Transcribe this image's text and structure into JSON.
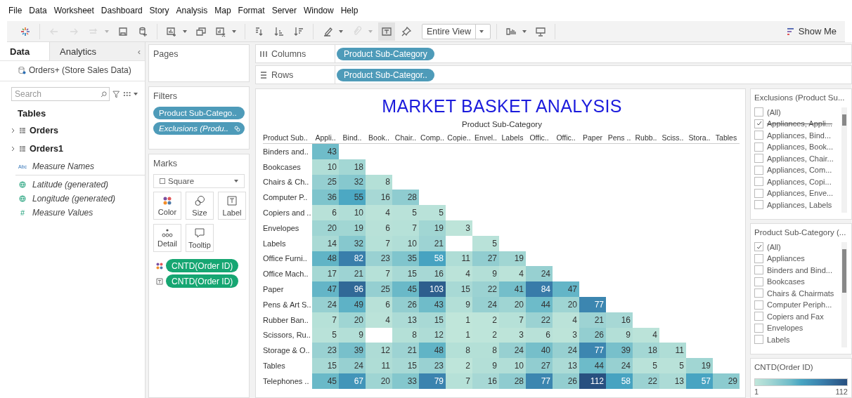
{
  "menu": [
    "File",
    "Data",
    "Worksheet",
    "Dashboard",
    "Story",
    "Analysis",
    "Map",
    "Format",
    "Server",
    "Window",
    "Help"
  ],
  "toolbar": [
    [
      {
        "kind": "logo",
        "disabled": false,
        "dropdown": false,
        "pressed": false
      }
    ],
    [
      {
        "kind": "back",
        "disabled": true,
        "dropdown": false,
        "pressed": false
      },
      {
        "kind": "forward",
        "disabled": true,
        "dropdown": false,
        "pressed": false
      },
      {
        "kind": "redo",
        "disabled": true,
        "dropdown": true,
        "pressed": false
      },
      {
        "kind": "save",
        "disabled": false,
        "dropdown": false,
        "pressed": false
      },
      {
        "kind": "new-data-source",
        "disabled": false,
        "dropdown": false,
        "pressed": false
      }
    ],
    [
      {
        "kind": "new-sheet",
        "disabled": false,
        "dropdown": true,
        "pressed": false
      },
      {
        "kind": "duplicate",
        "disabled": false,
        "dropdown": false,
        "pressed": false
      },
      {
        "kind": "clear-sheet",
        "disabled": false,
        "dropdown": true,
        "pressed": false
      }
    ],
    [
      {
        "kind": "swap",
        "disabled": false,
        "dropdown": false,
        "pressed": false
      },
      {
        "kind": "sort-ascending",
        "disabled": false,
        "dropdown": false,
        "pressed": false
      },
      {
        "kind": "sort-descending",
        "disabled": false,
        "dropdown": false,
        "pressed": false
      }
    ],
    [
      {
        "kind": "highlight",
        "disabled": false,
        "dropdown": true,
        "pressed": false
      },
      {
        "kind": "group",
        "disabled": true,
        "dropdown": true,
        "pressed": false
      },
      {
        "kind": "labels",
        "disabled": false,
        "dropdown": false,
        "pressed": true
      },
      {
        "kind": "pin",
        "disabled": false,
        "dropdown": false,
        "pressed": false
      },
      {
        "kind": "fit",
        "label": "Entire View",
        "disabled": false,
        "dropdown": true,
        "pressed": false
      }
    ],
    [
      {
        "kind": "cards",
        "disabled": false,
        "dropdown": true,
        "pressed": false
      },
      {
        "kind": "presentation",
        "disabled": false,
        "dropdown": false,
        "pressed": false
      }
    ]
  ],
  "show_me": "Show Me",
  "data_pane": {
    "tabs": [
      {
        "label": "Data",
        "selected": true
      },
      {
        "label": "Analytics",
        "selected": false
      }
    ],
    "collapse": "‹",
    "datasource": "Orders+ (Store Sales Data)",
    "search": {
      "placeholder": "Search"
    },
    "tables_heading": "Tables",
    "tables": [
      {
        "name": "Orders",
        "expanded": false
      },
      {
        "name": "Orders1",
        "expanded": false
      }
    ],
    "fields": [
      {
        "name": "Measure Names",
        "kind": "string",
        "icon": "Abc"
      },
      {
        "name": "Latitude (generated)",
        "kind": "geo"
      },
      {
        "name": "Longitude (generated)",
        "kind": "geo"
      },
      {
        "name": "Measure Values",
        "kind": "measure",
        "icon": "#"
      }
    ]
  },
  "pages": {
    "title": "Pages"
  },
  "filters": {
    "title": "Filters",
    "pills": [
      {
        "label": "Product Sub-Catego..",
        "italic": false,
        "linked": false
      },
      {
        "label": "Exclusions (Produ..",
        "italic": true,
        "linked": true
      }
    ]
  },
  "marks": {
    "title": "Marks",
    "mark_type": "Square",
    "buttons": [
      {
        "label": "Color",
        "kind": "color"
      },
      {
        "label": "Size",
        "kind": "size"
      },
      {
        "label": "Label",
        "kind": "label"
      },
      {
        "label": "Detail",
        "kind": "detail"
      },
      {
        "label": "Tooltip",
        "kind": "tooltip"
      }
    ],
    "pills": [
      {
        "label": "CNTD(Order ID)",
        "kind": "color"
      },
      {
        "label": "CNTD(Order ID)",
        "kind": "label"
      }
    ]
  },
  "shelves": [
    {
      "label": "Columns",
      "kind": "columns",
      "pills": [
        "Product Sub-Category"
      ]
    },
    {
      "label": "Rows",
      "kind": "rows",
      "pills": [
        "Product Sub-Categor.."
      ]
    }
  ],
  "view": {
    "title": "MARKET BASKET ANALYSIS",
    "subtitle": "Product Sub-Category",
    "corner": "Product Sub..",
    "columns": [
      "Appli..",
      "Bind..",
      "Book..",
      "Chair..",
      "Comp..",
      "Copie..",
      "Envel..",
      "Labels",
      "Offic..",
      "Offic..",
      "Paper",
      "Pens ..",
      "Rubb..",
      "Sciss..",
      "Stora..",
      "Tables"
    ],
    "rows": [
      {
        "label": "Binders and..",
        "cells": [
          "43"
        ]
      },
      {
        "label": "Bookcases",
        "cells": [
          "10",
          "18"
        ]
      },
      {
        "label": "Chairs & Ch..",
        "cells": [
          "25",
          "32",
          "8"
        ]
      },
      {
        "label": "Computer P..",
        "cells": [
          "36",
          "55",
          "16",
          "28"
        ]
      },
      {
        "label": "Copiers and ..",
        "cells": [
          "6",
          "10",
          "4",
          "5",
          "5"
        ]
      },
      {
        "label": "Envelopes",
        "cells": [
          "20",
          "19",
          "6",
          "7",
          "19",
          "3"
        ]
      },
      {
        "label": "Labels",
        "cells": [
          "14",
          "32",
          "7",
          "10",
          "21",
          null,
          "5"
        ]
      },
      {
        "label": "Office Furni..",
        "cells": [
          "48",
          "82",
          "23",
          "35",
          "58",
          "11",
          "27",
          "19"
        ]
      },
      {
        "label": "Office Mach..",
        "cells": [
          "17",
          "21",
          "7",
          "15",
          "16",
          "4",
          "9",
          "4",
          "24"
        ]
      },
      {
        "label": "Paper",
        "cells": [
          "47",
          "96",
          "25",
          "45",
          "103",
          "15",
          "22",
          "41",
          "84",
          "47"
        ]
      },
      {
        "label": "Pens & Art S..",
        "cells": [
          "24",
          "49",
          "6",
          "26",
          "43",
          "9",
          "24",
          "20",
          "44",
          "20",
          "77"
        ]
      },
      {
        "label": "Rubber Ban..",
        "cells": [
          "7",
          "20",
          "4",
          "13",
          "15",
          "1",
          "2",
          "7",
          "22",
          "4",
          "21",
          "16"
        ]
      },
      {
        "label": "Scissors, Ru..",
        "cells": [
          "5",
          "9",
          null,
          "8",
          "12",
          "1",
          "2",
          "3",
          "6",
          "3",
          "26",
          "9",
          "4"
        ]
      },
      {
        "label": "Storage & O..",
        "cells": [
          "23",
          "39",
          "12",
          "21",
          "48",
          "8",
          "8",
          "24",
          "40",
          "24",
          "77",
          "39",
          "18",
          "11"
        ]
      },
      {
        "label": "Tables",
        "cells": [
          "15",
          "24",
          "11",
          "15",
          "23",
          "2",
          "9",
          "10",
          "27",
          "13",
          "44",
          "24",
          "5",
          "5",
          "19"
        ]
      },
      {
        "label": "Telephones ..",
        "cells": [
          "45",
          "67",
          "20",
          "33",
          "79",
          "7",
          "16",
          "28",
          "77",
          "26",
          "112",
          "58",
          "22",
          "13",
          "57",
          "29"
        ]
      }
    ]
  },
  "quick_filters": [
    {
      "title": "Exclusions (Product Su...",
      "kind": "exclude",
      "items": [
        {
          "label": "(All)",
          "checked": false
        },
        {
          "label": "Appliances, Appli...",
          "checked": true
        },
        {
          "label": "Appliances, Bind...",
          "checked": false
        },
        {
          "label": "Appliances, Book...",
          "checked": false
        },
        {
          "label": "Appliances, Chair...",
          "checked": false
        },
        {
          "label": "Appliances, Com...",
          "checked": false
        },
        {
          "label": "Appliances, Copi...",
          "checked": false
        },
        {
          "label": "Appliances, Enve...",
          "checked": false
        },
        {
          "label": "Appliances, Labels",
          "checked": false
        }
      ]
    },
    {
      "title": "Product Sub-Category (...",
      "kind": "include",
      "items": [
        {
          "label": "(All)",
          "checked": true
        },
        {
          "label": "Appliances",
          "checked": false
        },
        {
          "label": "Binders and Bind...",
          "checked": false
        },
        {
          "label": "Bookcases",
          "checked": false
        },
        {
          "label": "Chairs & Chairmats",
          "checked": false
        },
        {
          "label": "Computer Periph...",
          "checked": false
        },
        {
          "label": "Copiers and Fax",
          "checked": false
        },
        {
          "label": "Envelopes",
          "checked": false
        },
        {
          "label": "Labels",
          "checked": false
        }
      ]
    }
  ],
  "legend": {
    "title": "CNTD(Order ID)",
    "min": "1",
    "max": "112"
  }
}
